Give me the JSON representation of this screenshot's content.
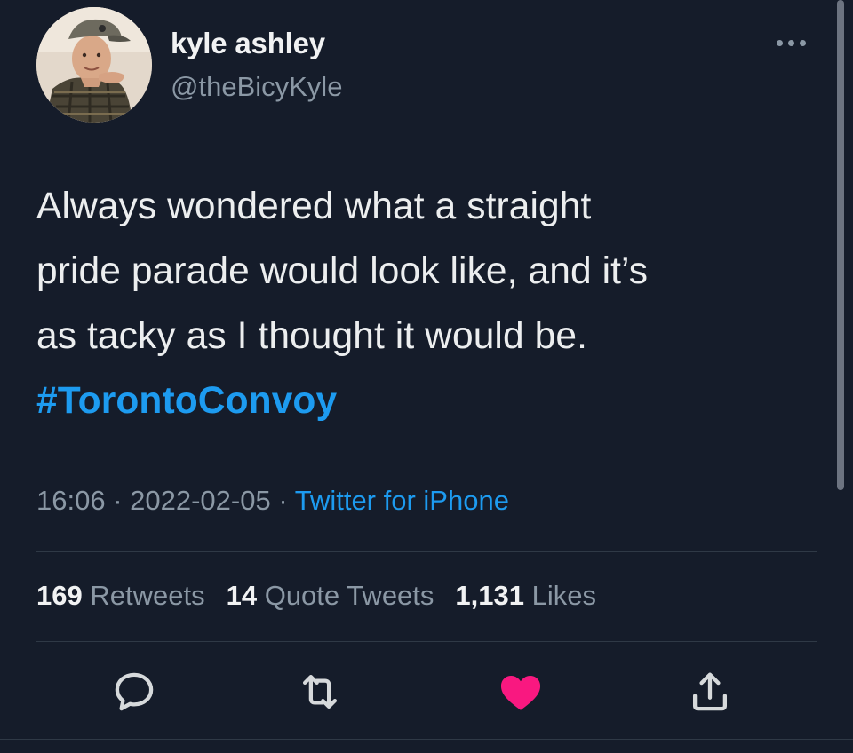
{
  "author": {
    "display_name": "kyle ashley",
    "handle": "@theBicyKyle"
  },
  "tweet": {
    "lines": [
      "Always wondered what a straight",
      "pride parade would look like, and it’s",
      "as tacky as I thought it would be."
    ],
    "hashtag": "#TorontoConvoy"
  },
  "meta": {
    "time": "16:06",
    "separator": " · ",
    "date": "2022-02-05",
    "source": "Twitter for iPhone"
  },
  "stats": {
    "retweets_count": "169",
    "retweets_label": "Retweets",
    "quotes_count": "14",
    "quotes_label": "Quote Tweets",
    "likes_count": "1,131",
    "likes_label": "Likes"
  },
  "icons": {
    "more": "more-horizontal-icon",
    "reply": "reply-icon",
    "retweet": "retweet-icon",
    "like": "heart-filled-icon",
    "share": "share-icon"
  },
  "colors": {
    "background": "#151c2a",
    "link": "#1d9bf0",
    "like_active": "#f91880",
    "muted": "#8b98a5"
  }
}
